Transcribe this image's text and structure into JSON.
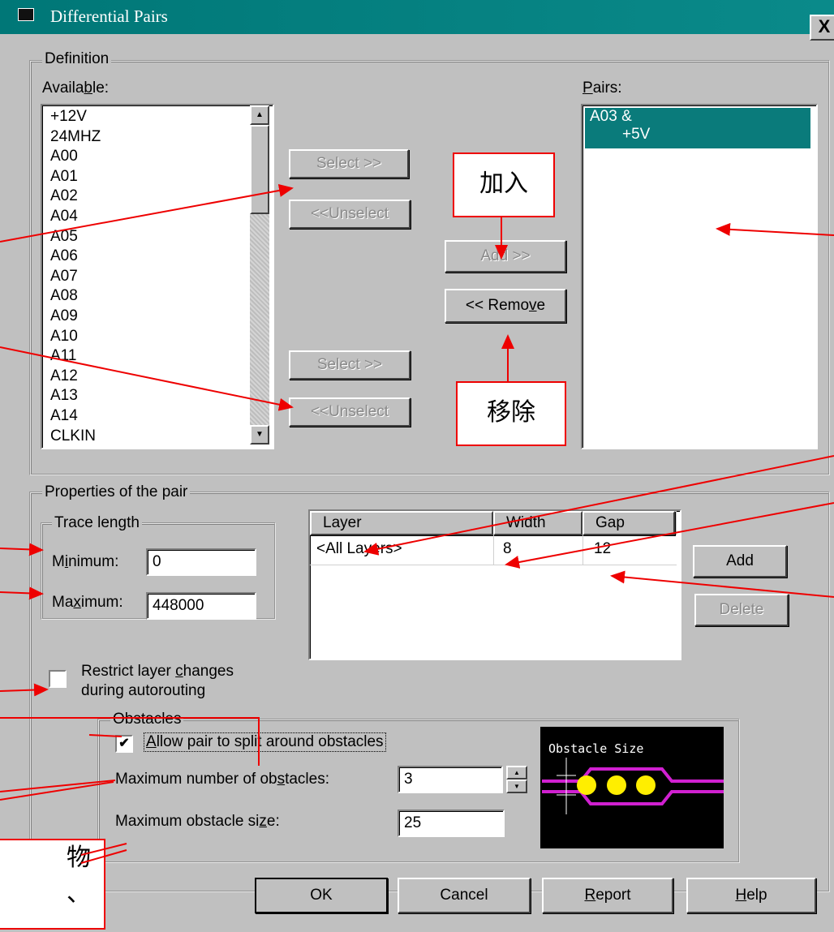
{
  "window": {
    "title": "Differential Pairs",
    "close_label": "X"
  },
  "definition": {
    "group_label": "Definition",
    "available_label": "Available:",
    "available_items": [
      "+12V",
      "24MHZ",
      "A00",
      "A01",
      "A02",
      "A04",
      "A05",
      "A06",
      "A07",
      "A08",
      "A09",
      "A10",
      "A11",
      "A12",
      "A13",
      "A14",
      "CLKIN"
    ],
    "pairs_label": "Pairs:",
    "pairs_selected": {
      "line1": "A03 &",
      "line2": "+5V"
    },
    "select_top_label": "Select >>",
    "unselect_top_label": "<<Unselect",
    "select_bottom_label": "Select >>",
    "unselect_bottom_label": "<<Unselect",
    "add_label": "Add >>",
    "remove_label": "<< Remove"
  },
  "annotations": {
    "add_note": "加入",
    "remove_note": "移除",
    "partial_note_1": "物",
    "partial_note_2": "、"
  },
  "properties": {
    "group_label": "Properties of the pair",
    "trace_length": {
      "group_label": "Trace length",
      "minimum_label": "Minimum:",
      "minimum_value": "0",
      "maximum_label": "Maximum:",
      "maximum_value": "448000"
    },
    "layers_table": {
      "headers": [
        "Layer",
        "Width",
        "Gap"
      ],
      "rows": [
        {
          "layer": "<All Layers>",
          "width": "8",
          "gap": "12"
        }
      ]
    },
    "add_button_label": "Add",
    "delete_button_label": "Delete",
    "restrict_label_line1": "Restrict layer changes",
    "restrict_label_line2": "during autorouting",
    "restrict_checked": false
  },
  "obstacles": {
    "group_label": "Obstacles",
    "allow_split_label": "Allow pair to split around obstacles",
    "allow_split_checked": true,
    "max_number_label": "Maximum number of obstacles:",
    "max_number_value": "3",
    "max_size_label": "Maximum obstacle size:",
    "max_size_value": "25",
    "preview_label": "Obstacle Size"
  },
  "footer": {
    "ok_label": "OK",
    "cancel_label": "Cancel",
    "report_label": "Report",
    "help_label": "Help"
  }
}
